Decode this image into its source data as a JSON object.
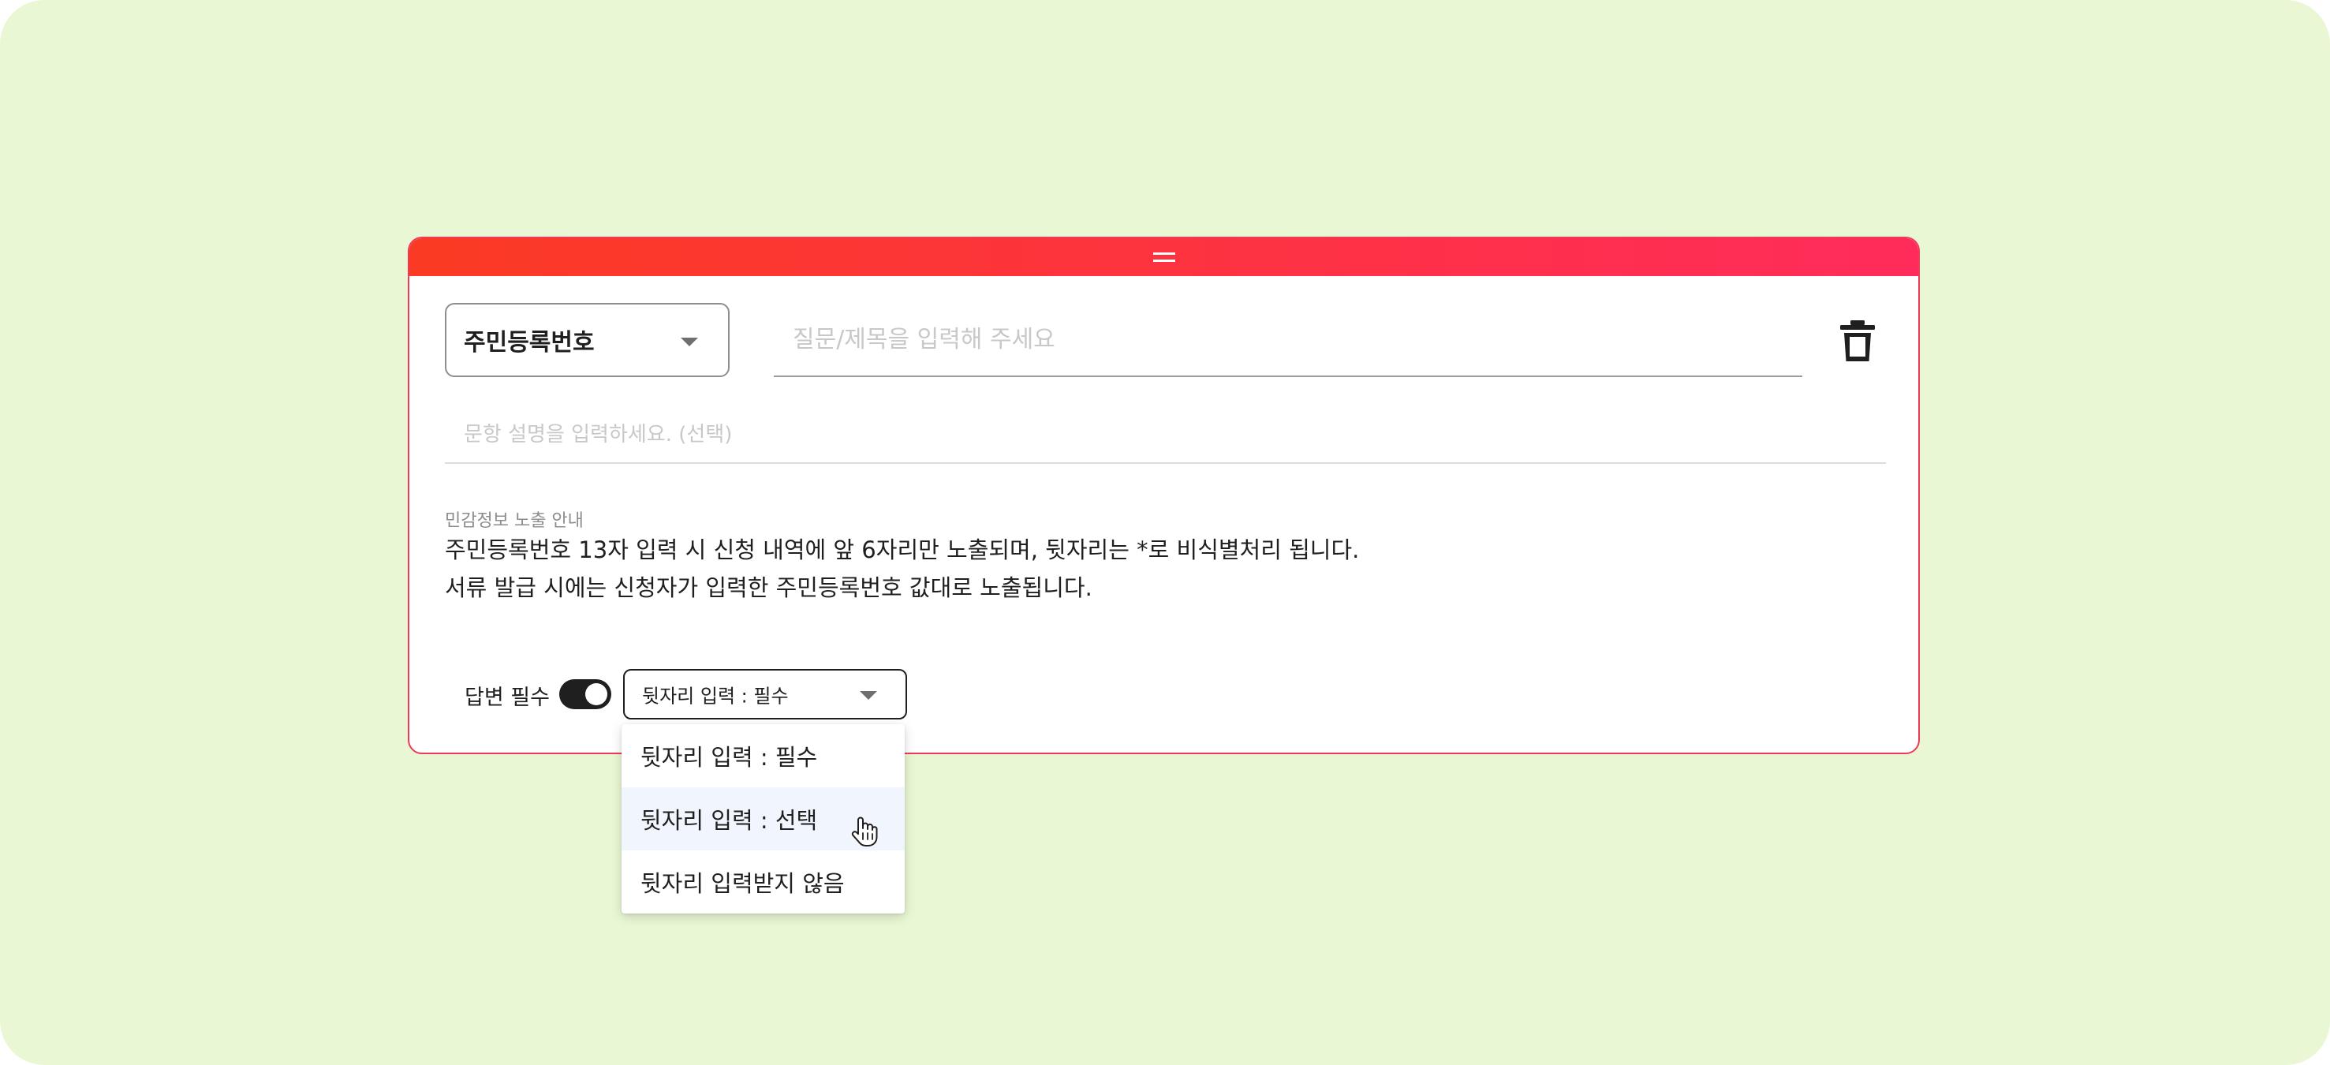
{
  "question": {
    "type_label": "주민등록번호",
    "title_placeholder": "질문/제목을 입력해 주세요",
    "description_placeholder": "문항 설명을 입력하세요. (선택)"
  },
  "notice": {
    "title": "민감정보 노출 안내",
    "line1": "주민등록번호 13자 입력 시 신청 내역에 앞 6자리만 노출되며, 뒷자리는 *로 비식별처리 됩니다.",
    "line2": "서류 발급 시에는 신청자가 입력한 주민등록번호 값대로 노출됩니다."
  },
  "controls": {
    "required_label": "답변 필수",
    "required_on": true,
    "rear_select_value": "뒷자리 입력 : 필수"
  },
  "menu": {
    "items": [
      {
        "label": "뒷자리 입력 : 필수"
      },
      {
        "label": "뒷자리 입력 : 선택"
      },
      {
        "label": "뒷자리 입력받지 않음"
      }
    ],
    "hovered_index": 1
  },
  "icons": {
    "drag": "drag-handle-icon",
    "caret": "chevron-down-icon",
    "trash": "trash-icon",
    "cursor": "hand-pointer-icon"
  },
  "colors": {
    "background": "#e9f7d4",
    "accent_start": "#fb3a23",
    "accent_end": "#ff2c5b",
    "card_border": "#ee3a57",
    "text": "#1f1f1f",
    "placeholder": "#c8c8c8",
    "hover": "#f1f5fd"
  }
}
